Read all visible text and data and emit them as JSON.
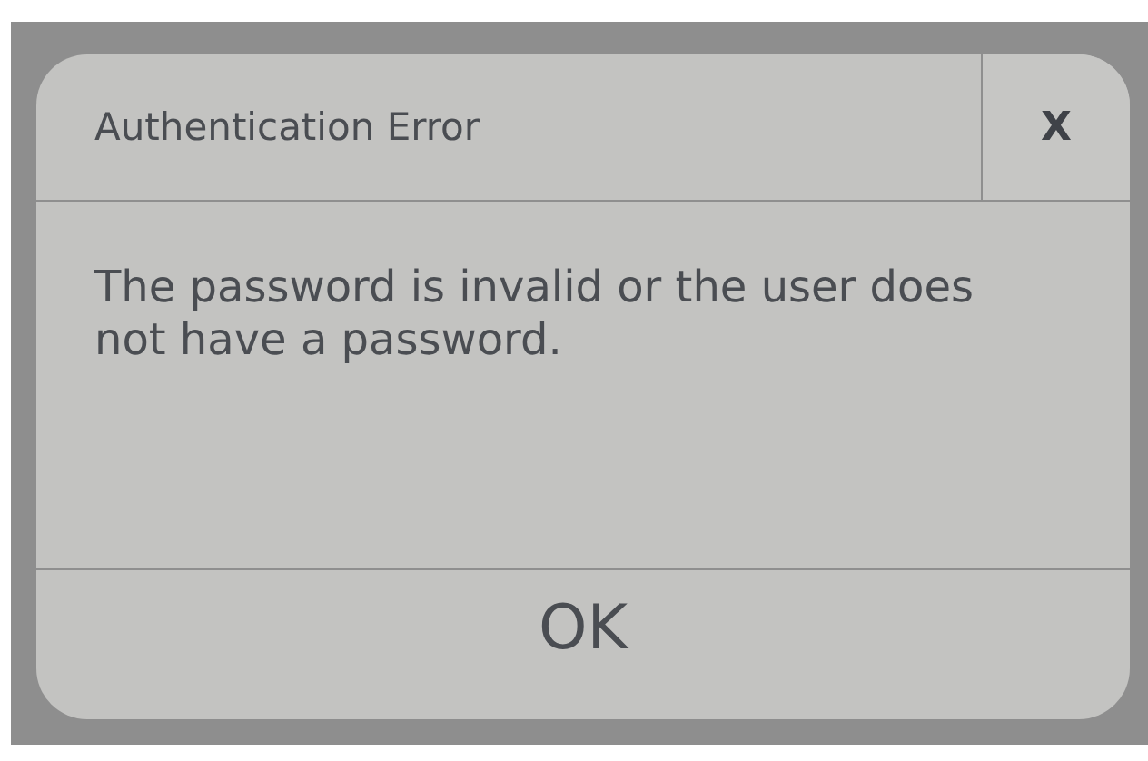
{
  "dialog": {
    "title": "Authentication Error",
    "close": "X",
    "message": "The password is invalid or the user does not have a password.",
    "buttons": [
      "OK"
    ]
  }
}
